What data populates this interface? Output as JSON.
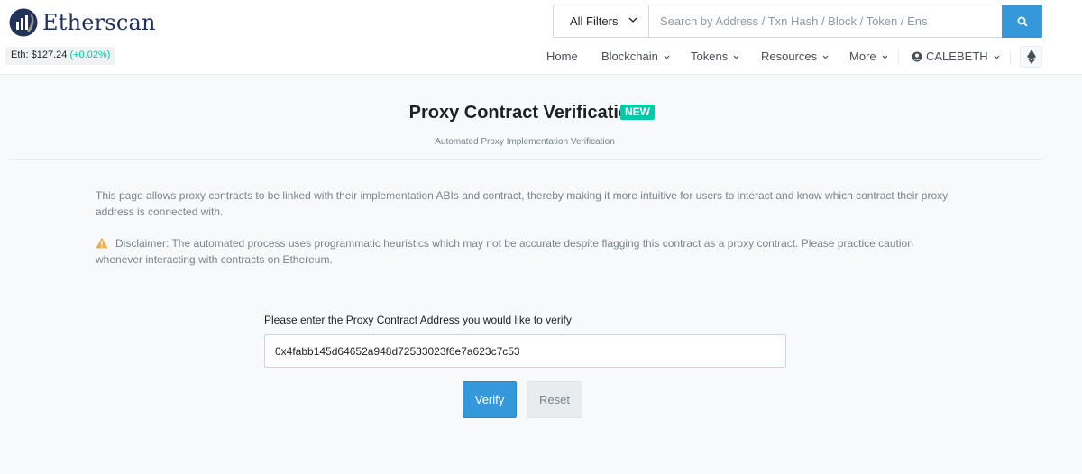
{
  "brand": {
    "name": "Etherscan",
    "logo_icon": "etherscan-logo-icon"
  },
  "price": {
    "label": "Eth:",
    "value": "$127.24",
    "change": "(+0.02%)",
    "change_color": "#00c9a7"
  },
  "search": {
    "filter_label": "All Filters",
    "placeholder": "Search by Address / Txn Hash / Block / Token / Ens",
    "button_icon": "search-icon"
  },
  "nav": {
    "items": [
      {
        "label": "Home"
      },
      {
        "label": "Blockchain"
      },
      {
        "label": "Tokens"
      },
      {
        "label": "Resources"
      },
      {
        "label": "More"
      }
    ],
    "user": "CALEBETH",
    "network_icon": "ethereum-icon"
  },
  "page": {
    "title": "Proxy Contract Verification",
    "badge": "NEW",
    "subtitle": "Automated Proxy Implementation Verification",
    "description": "This page allows proxy contracts to be linked with their implementation ABIs and contract, thereby making it more intuitive for users to interact and know which contract their proxy address is connected with.",
    "disclaimer": "Disclaimer: The automated process uses programmatic heuristics which may not be accurate despite flagging this contract as a proxy contract. Please practice caution whenever interacting with contracts on Ethereum."
  },
  "form": {
    "label": "Please enter the Proxy Contract Address you would like to verify",
    "address_value": "0x4fabb145d64652a948d72533023f6e7a623c7c53",
    "verify_label": "Verify",
    "reset_label": "Reset"
  },
  "colors": {
    "accent": "#3498db",
    "brand_navy": "#21325b",
    "new_badge": "#00c9a7",
    "warning": "#f0ad4e"
  }
}
